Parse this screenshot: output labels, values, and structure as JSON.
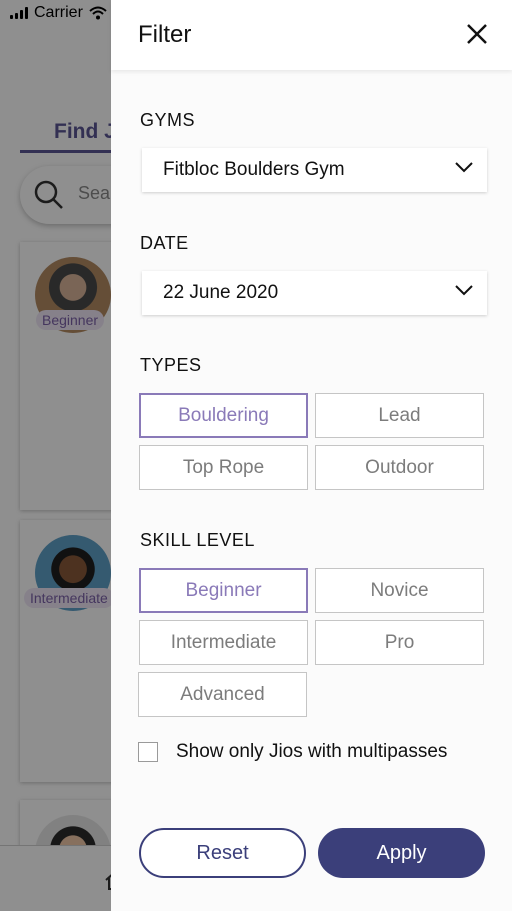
{
  "status_bar": {
    "carrier": "Carrier"
  },
  "background": {
    "tab_label": "Find J",
    "search_placeholder": "Sea",
    "cards": [
      {
        "level": "Beginner"
      },
      {
        "level": "Intermediate"
      }
    ]
  },
  "filter": {
    "title": "Filter",
    "gyms": {
      "label": "GYMS",
      "value": "Fitbloc Boulders Gym"
    },
    "date": {
      "label": "DATE",
      "value": "22 June 2020"
    },
    "types": {
      "label": "TYPES",
      "options": [
        "Bouldering",
        "Lead",
        "Top Rope",
        "Outdoor"
      ],
      "selected": "Bouldering"
    },
    "skill_level": {
      "label": "SKILL LEVEL",
      "options": [
        "Beginner",
        "Novice",
        "Intermediate",
        "Pro",
        "Advanced"
      ],
      "selected": "Beginner"
    },
    "multipass_checkbox": {
      "label": "Show only Jios with multipasses",
      "checked": false
    },
    "reset_label": "Reset",
    "apply_label": "Apply"
  },
  "colors": {
    "accent": "#3b3f7a",
    "selected_chip": "#8a7ab8",
    "chip_border": "#c5c5c5",
    "tag_bg": "#efe6f7"
  }
}
